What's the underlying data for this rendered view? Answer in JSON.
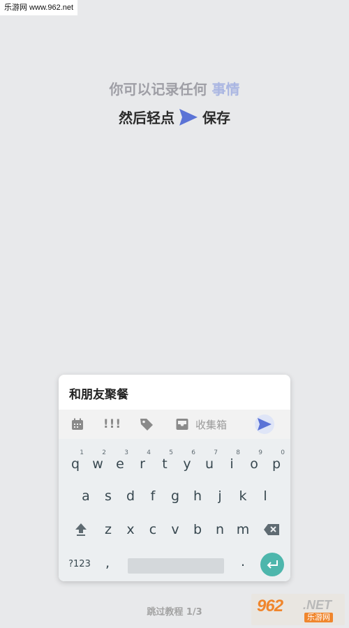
{
  "watermark_top": "乐游网 www.962.net",
  "hint": {
    "line1_prefix": "你可以记录任何",
    "line1_highlight": "事情",
    "line2_prefix": "然后轻点",
    "line2_suffix": "保存"
  },
  "task": {
    "value": "和朋友聚餐"
  },
  "toolbar": {
    "calendar_icon": "calendar-icon",
    "priority_label": "!!!",
    "tag_icon": "tag-icon",
    "inbox_icon": "inbox-icon",
    "inbox_label": "收集箱",
    "send_icon": "send-icon",
    "accent": "#5b73d6"
  },
  "keyboard": {
    "row1": [
      {
        "key": "q",
        "hint": "1"
      },
      {
        "key": "w",
        "hint": "2"
      },
      {
        "key": "e",
        "hint": "3"
      },
      {
        "key": "r",
        "hint": "4"
      },
      {
        "key": "t",
        "hint": "5"
      },
      {
        "key": "y",
        "hint": "6"
      },
      {
        "key": "u",
        "hint": "7"
      },
      {
        "key": "i",
        "hint": "8"
      },
      {
        "key": "o",
        "hint": "9"
      },
      {
        "key": "p",
        "hint": "0"
      }
    ],
    "row2": [
      "a",
      "s",
      "d",
      "f",
      "g",
      "h",
      "j",
      "k",
      "l"
    ],
    "row3": [
      "z",
      "x",
      "c",
      "v",
      "b",
      "n",
      "m"
    ],
    "symbols_label": "?123",
    "comma": ",",
    "period": ".",
    "enter_color": "#4db6ac"
  },
  "footer": {
    "skip_label": "跳过教程 1/3"
  },
  "watermark_br": {
    "brand_num": "962",
    "brand_net": ".NET",
    "brand_cn": "乐游网"
  }
}
